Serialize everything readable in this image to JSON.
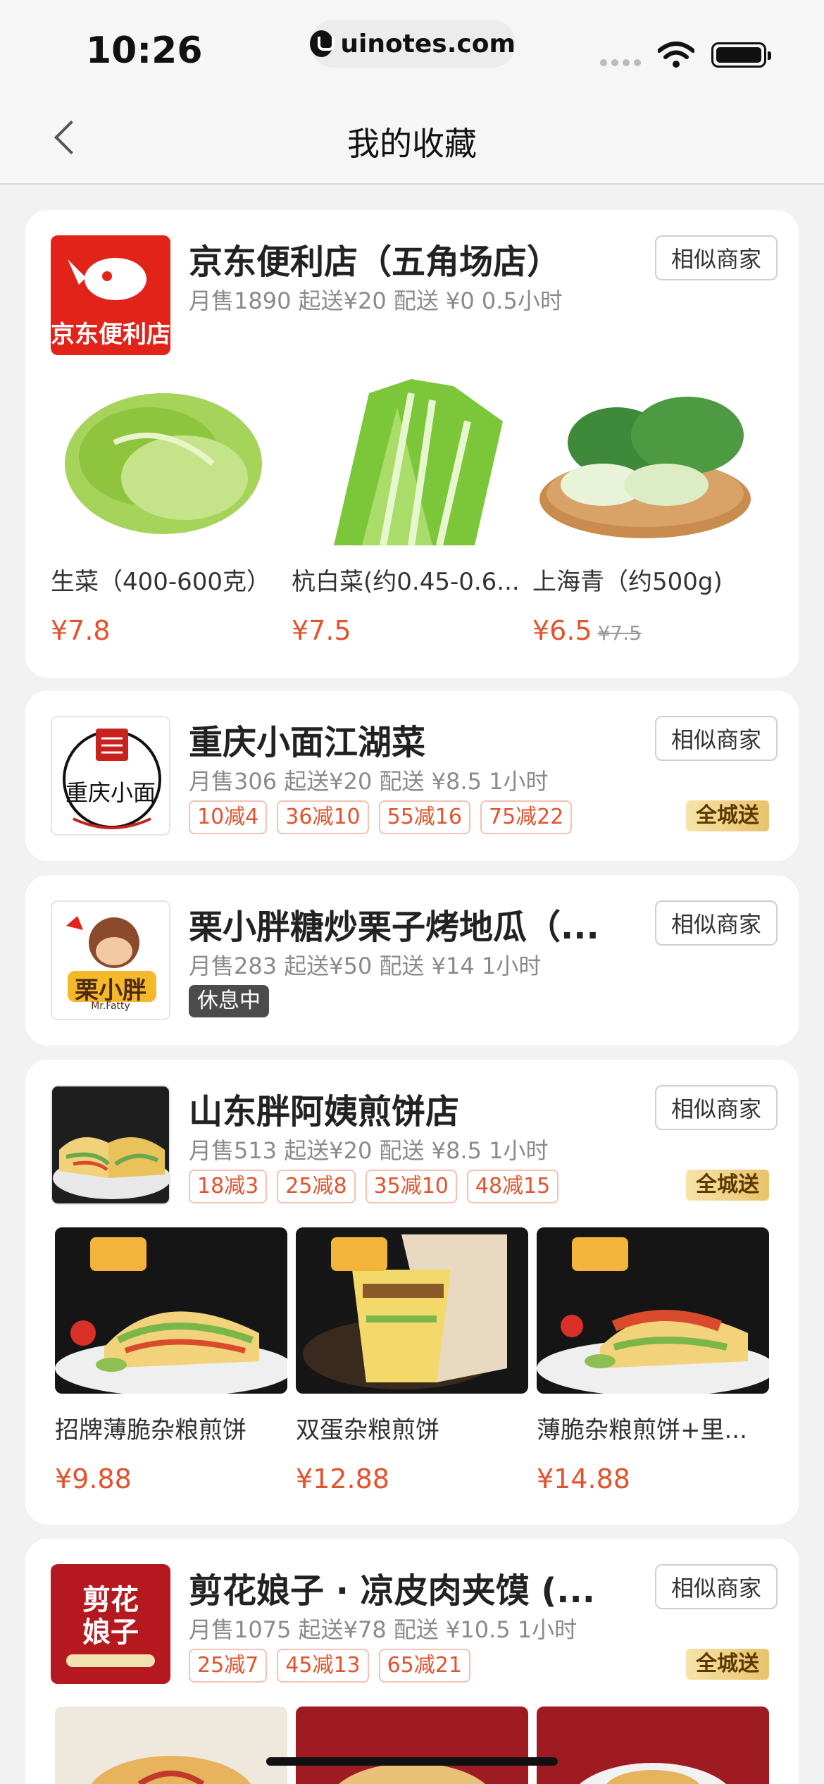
{
  "status": {
    "time": "10:26",
    "url": "uinotes.com"
  },
  "nav": {
    "title": "我的收藏"
  },
  "common": {
    "similar": "相似商家",
    "citywide": "全城送",
    "closed": "休息中"
  },
  "shops": [
    {
      "name": "京东便利店（五角场店）",
      "meta": "月售1890  起送¥20  配送 ¥0  0.5小时",
      "logo_text": "京东便利店",
      "products": [
        {
          "name": "生菜（400-600克）",
          "price": "¥7.8",
          "old_price": ""
        },
        {
          "name": "杭白菜(约0.45-0.6...",
          "price": "¥7.5",
          "old_price": ""
        },
        {
          "name": "上海青（约500g)",
          "price": "¥6.5",
          "old_price": "¥7.5"
        }
      ]
    },
    {
      "name": "重庆小面江湖菜",
      "meta": "月售306  起送¥20  配送 ¥8.5  1小时",
      "logo_text": "重庆小面",
      "promos": [
        "10减4",
        "36减10",
        "55减16",
        "75减22"
      ]
    },
    {
      "name": "栗小胖糖炒栗子烤地瓜（...",
      "meta": "月售283  起送¥50  配送 ¥14  1小时",
      "logo_text": "栗小胖",
      "logo_sub": "Mr.Fatty"
    },
    {
      "name": "山东胖阿姨煎饼店",
      "meta": "月售513  起送¥20  配送 ¥8.5  1小时",
      "promos": [
        "18减3",
        "25减8",
        "35减10",
        "48减15"
      ],
      "products": [
        {
          "name": "招牌薄脆杂粮煎饼",
          "price": "¥9.88"
        },
        {
          "name": "双蛋杂粮煎饼",
          "price": "¥12.88"
        },
        {
          "name": "薄脆杂粮煎饼+里...",
          "price": "¥14.88"
        }
      ]
    },
    {
      "name": "剪花娘子 · 凉皮肉夹馍 (...",
      "meta": "月售1075  起送¥78  配送 ¥10.5  1小时",
      "logo_text": "剪花娘子",
      "promos": [
        "25减7",
        "45减13",
        "65减21"
      ]
    }
  ]
}
